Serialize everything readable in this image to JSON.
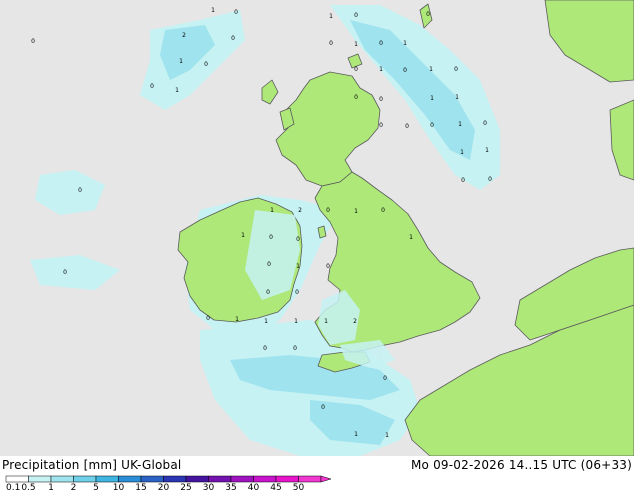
{
  "colors": {
    "sea": "#e6e6e6",
    "land": "#ade879",
    "coast": "#5a5a5a",
    "precip_light": "#c6f2f4",
    "precip_mid": "#9fe3ee",
    "precip_strong": "#5fc8e6"
  },
  "footer": {
    "title": "Precipitation [mm] UK-Global",
    "datetime": "Mo 09-02-2026 14..15 UTC (06+33)"
  },
  "colorbar": {
    "labels": [
      "0.1",
      "0.5",
      "1",
      "2",
      "5",
      "10",
      "15",
      "20",
      "25",
      "30",
      "35",
      "40",
      "45",
      "50"
    ],
    "colors": [
      "#ffffff",
      "#c6f2f4",
      "#9fe3ee",
      "#6fd0ea",
      "#3fb6e2",
      "#2a8fd8",
      "#2a62c8",
      "#2a36b4",
      "#4414a0",
      "#7412b0",
      "#a012c0",
      "#c812cc",
      "#e814cc",
      "#f038d0"
    ]
  },
  "map_values": [
    {
      "id": "v01",
      "text": "1"
    },
    {
      "id": "v02",
      "text": "0"
    },
    {
      "id": "v03",
      "text": "0"
    },
    {
      "id": "v04",
      "text": "2"
    },
    {
      "id": "v05",
      "text": "0"
    },
    {
      "id": "v06",
      "text": "1"
    },
    {
      "id": "v07",
      "text": "0"
    },
    {
      "id": "v08",
      "text": "0"
    },
    {
      "id": "v09",
      "text": "1"
    },
    {
      "id": "v10",
      "text": "1"
    },
    {
      "id": "v11",
      "text": "0"
    },
    {
      "id": "v12",
      "text": "0"
    },
    {
      "id": "v13",
      "text": "0"
    },
    {
      "id": "v14",
      "text": "1"
    },
    {
      "id": "v15",
      "text": "0"
    },
    {
      "id": "v16",
      "text": "1"
    },
    {
      "id": "v17",
      "text": "0"
    },
    {
      "id": "v18",
      "text": "1"
    },
    {
      "id": "v19",
      "text": "0"
    },
    {
      "id": "v20",
      "text": "1"
    },
    {
      "id": "v21",
      "text": "0"
    },
    {
      "id": "v22",
      "text": "0"
    },
    {
      "id": "v23",
      "text": "0"
    },
    {
      "id": "v24",
      "text": "1"
    },
    {
      "id": "v25",
      "text": "0"
    },
    {
      "id": "v26",
      "text": "1"
    },
    {
      "id": "v27",
      "text": "1"
    },
    {
      "id": "v28",
      "text": "1"
    },
    {
      "id": "v29",
      "text": "1"
    },
    {
      "id": "v30",
      "text": "0"
    },
    {
      "id": "v31",
      "text": "0"
    },
    {
      "id": "v32",
      "text": "0"
    },
    {
      "id": "v33",
      "text": "1"
    },
    {
      "id": "v34",
      "text": "2"
    },
    {
      "id": "v35",
      "text": "0"
    },
    {
      "id": "v36",
      "text": "1"
    },
    {
      "id": "v37",
      "text": "0"
    },
    {
      "id": "v38",
      "text": "0"
    },
    {
      "id": "v39",
      "text": "0"
    },
    {
      "id": "v40",
      "text": "0"
    },
    {
      "id": "v41",
      "text": "1"
    },
    {
      "id": "v42",
      "text": "0"
    },
    {
      "id": "v43",
      "text": "0"
    },
    {
      "id": "v44",
      "text": "1"
    },
    {
      "id": "v45",
      "text": "0"
    },
    {
      "id": "v46",
      "text": "0"
    },
    {
      "id": "v47",
      "text": "1"
    },
    {
      "id": "v48",
      "text": "0"
    },
    {
      "id": "v49",
      "text": "0"
    },
    {
      "id": "v50",
      "text": "0"
    },
    {
      "id": "v51",
      "text": "0"
    },
    {
      "id": "v52",
      "text": "1"
    },
    {
      "id": "v53",
      "text": "1"
    },
    {
      "id": "v54",
      "text": "1"
    },
    {
      "id": "v55",
      "text": "1"
    },
    {
      "id": "v56",
      "text": "2"
    },
    {
      "id": "v57",
      "text": "0"
    },
    {
      "id": "v58",
      "text": "0"
    },
    {
      "id": "v59",
      "text": "0"
    },
    {
      "id": "v60",
      "text": "0"
    },
    {
      "id": "v61",
      "text": "1"
    },
    {
      "id": "v62",
      "text": "1"
    }
  ]
}
